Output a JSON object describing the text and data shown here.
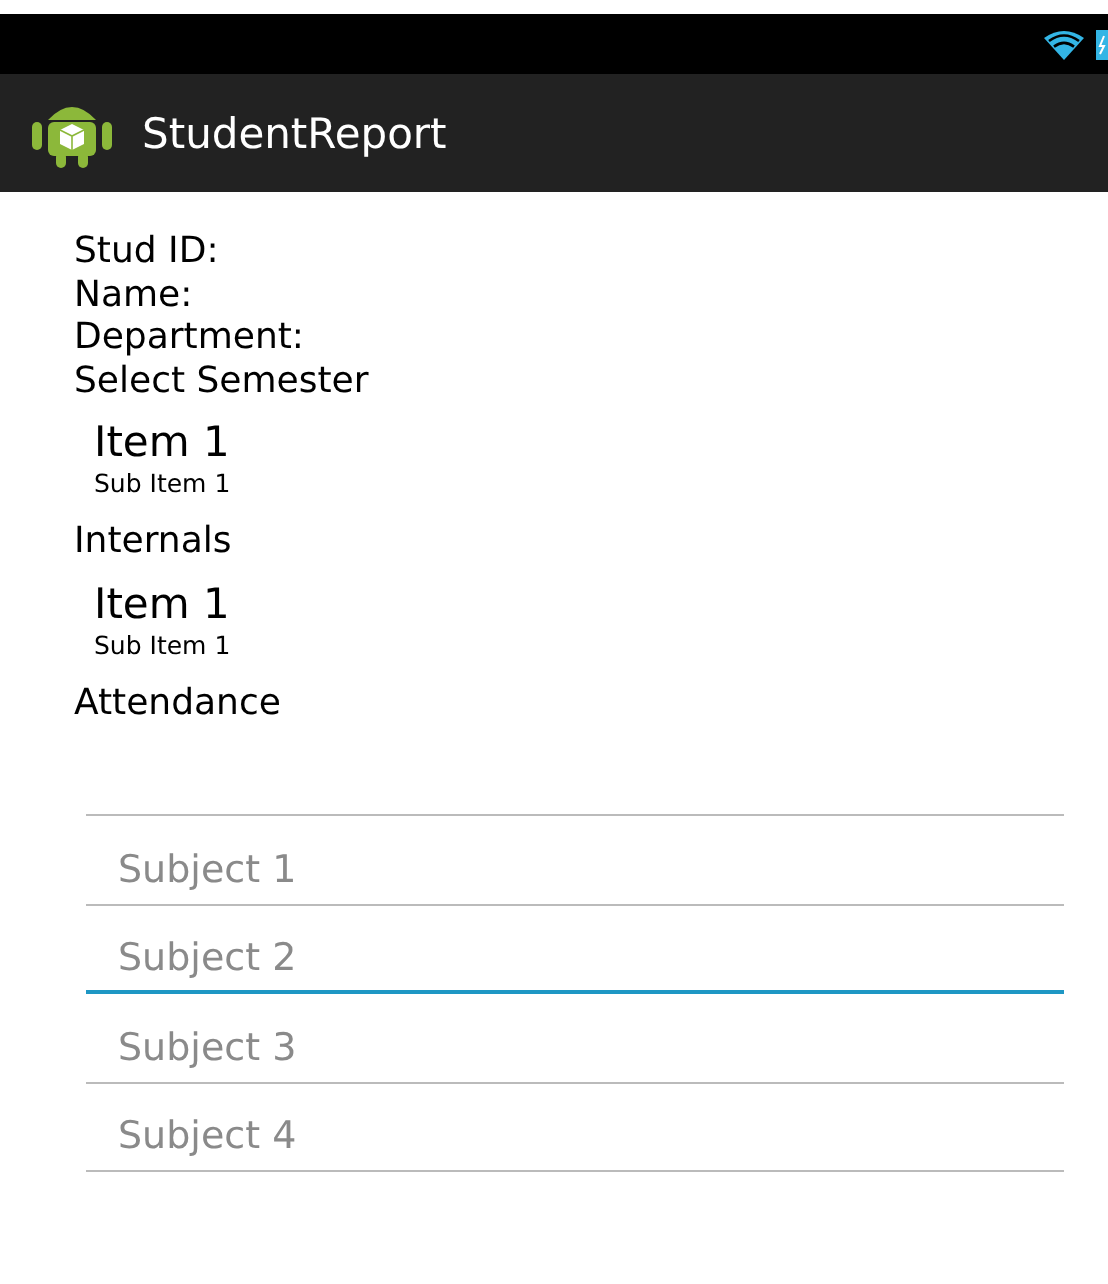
{
  "action_bar": {
    "title": "StudentReport"
  },
  "labels": [
    "Stud ID:",
    "Name:",
    "Department:"
  ],
  "sections": [
    {
      "heading": "Select Semester",
      "item": {
        "title": "Item 1",
        "subtitle": "Sub Item 1"
      }
    },
    {
      "heading": "Internals",
      "item": {
        "title": "Item 1",
        "subtitle": "Sub Item 1"
      }
    },
    {
      "heading": "Attendance"
    }
  ],
  "fields": [
    {
      "focused": false
    },
    {
      "placeholder": "Subject 1",
      "focused": false
    },
    {
      "placeholder": "Subject 2",
      "focused": true
    },
    {
      "placeholder": "Subject 3",
      "focused": false
    },
    {
      "placeholder": "Subject 4",
      "focused": false
    }
  ]
}
